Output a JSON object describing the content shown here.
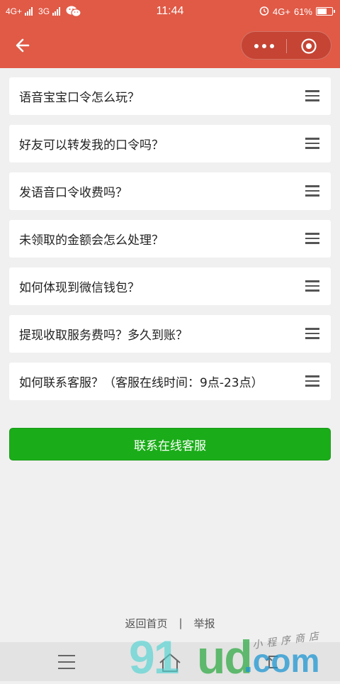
{
  "status_bar": {
    "network_left": "4G+",
    "network_mid": "3G",
    "time": "11:44",
    "network_right": "4G+",
    "battery": "61%",
    "battery_level": 0.61
  },
  "nav": {
    "back_icon": "arrow-left-icon",
    "more_icon": "more-dots-icon",
    "close_icon": "target-close-icon"
  },
  "faq": {
    "items": [
      {
        "label": "语音宝宝口令怎么玩？"
      },
      {
        "label": "好友可以转发我的口令吗？"
      },
      {
        "label": "发语音口令收费吗？"
      },
      {
        "label": "未领取的金额会怎么处理？"
      },
      {
        "label": "如何体现到微信钱包？"
      },
      {
        "label": "提现收取服务费吗？多久到账？"
      },
      {
        "label": "如何联系客服？（客服在线时间：9点-23点）"
      }
    ]
  },
  "actions": {
    "contact_label": "联系在线客服"
  },
  "footer": {
    "home_link": "返回首页",
    "separator": "|",
    "report_link": "举报"
  },
  "watermark": {
    "brand_a": "91",
    "brand_b": "ud",
    "brand_c": ".com",
    "tagline": "小程序商店"
  },
  "colors": {
    "header": "#e05a46",
    "primary_button": "#1aad19",
    "background": "#f0f0f0"
  }
}
